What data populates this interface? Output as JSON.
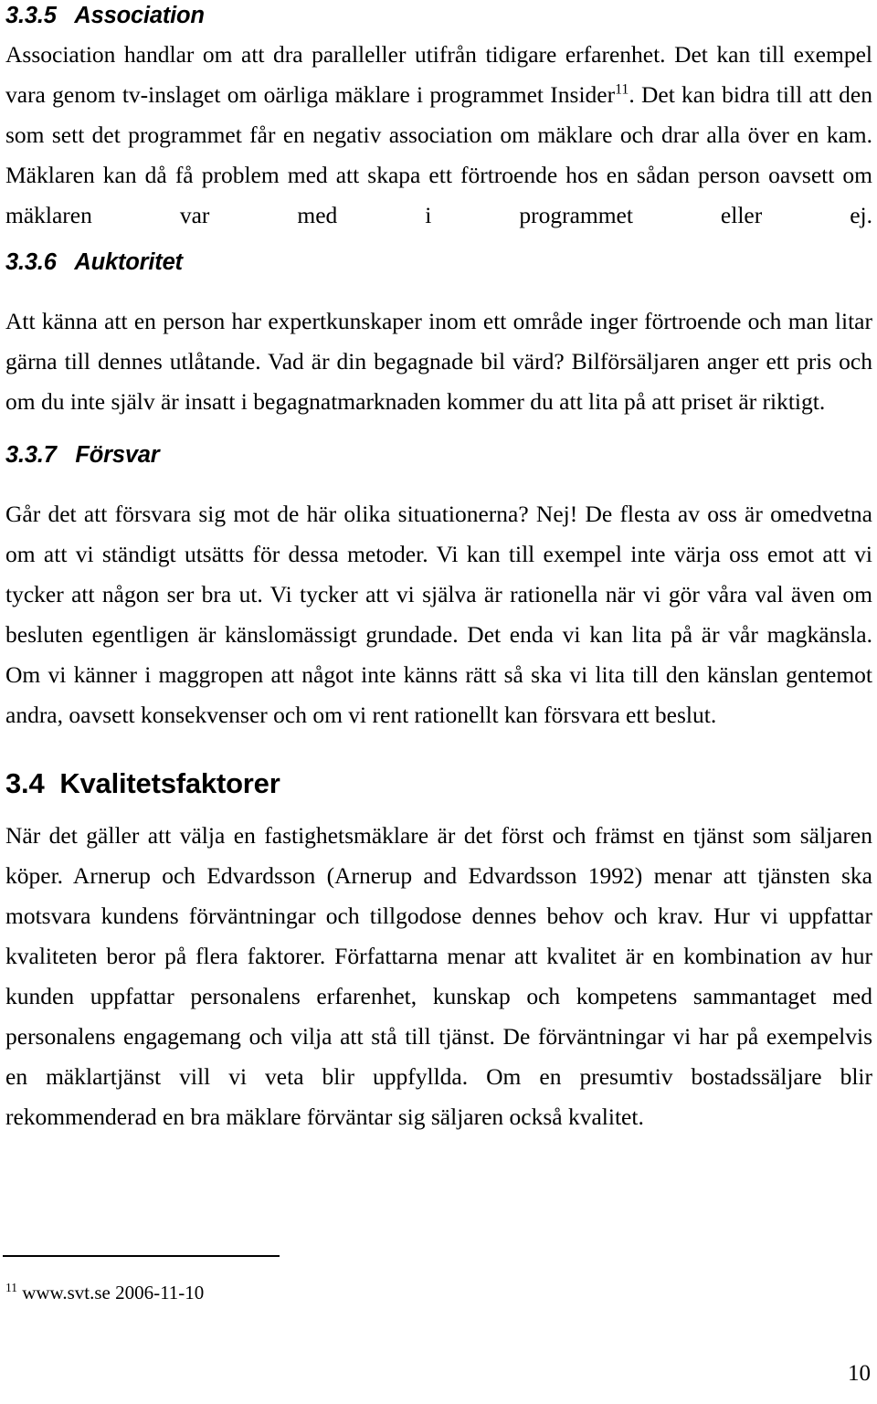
{
  "document": {
    "page_number": "10"
  },
  "sections": [
    {
      "heading_number": "3.3.5",
      "heading_title": "Association",
      "heading": "3.3.5   Association",
      "body_part1": "Association handlar om att dra paralleller utifrån tidigare erfarenhet. Det kan till exempel vara genom tv-inslaget om oärliga mäklare i programmet Insider",
      "footnote_marker": "11",
      "body_part2": ". Det kan bidra till att den som sett det programmet får en negativ association om mäklare och drar alla över en kam. Mäklaren kan då få problem med att skapa ett förtroende hos en sådan person oavsett om mäklaren var med i programmet eller ej."
    },
    {
      "heading_number": "3.3.6",
      "heading_title": "Auktoritet",
      "heading": "3.3.6   Auktoritet",
      "body": "Att känna att en person har expertkunskaper inom ett område inger förtroende och man litar gärna till dennes utlåtande. Vad är din begagnade bil värd? Bilförsäljaren anger ett pris och om du inte själv är insatt i begagnatmarknaden kommer du att lita på att priset är riktigt."
    },
    {
      "heading_number": "3.3.7",
      "heading_title": "Försvar",
      "heading": "3.3.7   Försvar",
      "body": "Går det att försvara sig mot de här olika situationerna? Nej! De flesta av oss är omedvetna om att vi ständigt utsätts för dessa metoder. Vi kan till exempel inte värja oss emot att vi tycker att någon ser bra ut. Vi tycker att vi själva är rationella när vi gör våra val även om besluten egentligen är känslomässigt grundade. Det enda vi kan lita på är vår magkänsla. Om vi känner i maggropen att något inte känns rätt så ska vi lita till den känslan gentemot andra, oavsett konsekvenser och om vi rent rationellt kan försvara ett beslut."
    },
    {
      "heading_number": "3.4",
      "heading_title": "Kvalitetsfaktorer",
      "heading": "3.4  Kvalitetsfaktorer",
      "body": "När det gäller att välja en fastighetsmäklare är det först och främst en tjänst som säljaren köper. Arnerup och Edvardsson (Arnerup and Edvardsson 1992) menar att tjänsten ska motsvara kundens förväntningar och tillgodose dennes behov och krav. Hur vi uppfattar kvaliteten beror på flera faktorer. Författarna menar att kvalitet är en kombination av hur kunden uppfattar personalens erfarenhet, kunskap och kompetens sammantaget med personalens engagemang och vilja att stå till tjänst. De förväntningar vi har på exempelvis en mäklartjänst vill vi veta blir uppfyllda. Om en presumtiv bostadssäljare blir rekommenderad en bra mäklare förväntar sig säljaren också kvalitet."
    }
  ],
  "footnote": {
    "marker": "11",
    "text": " www.svt.se 2006-11-10"
  }
}
